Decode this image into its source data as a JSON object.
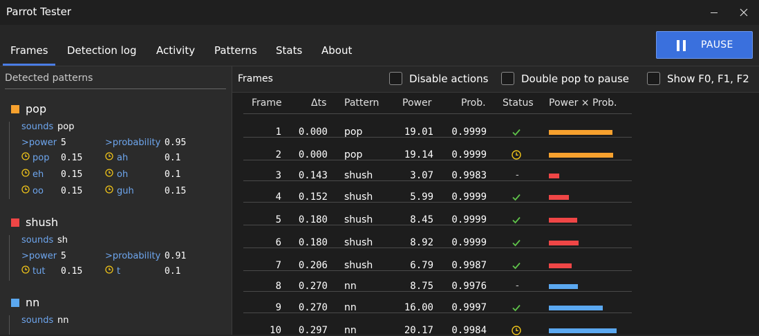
{
  "app_title": "Parrot Tester",
  "tabs": [
    {
      "label": "Frames",
      "active": true
    },
    {
      "label": "Detection log"
    },
    {
      "label": "Activity"
    },
    {
      "label": "Patterns"
    },
    {
      "label": "Stats"
    },
    {
      "label": "About"
    }
  ],
  "pause_button": {
    "label": "PAUSE",
    "icon": "pause-icon"
  },
  "left_panel": {
    "header": "Detected patterns",
    "patterns": [
      {
        "name": "pop",
        "color": "#f7a12e",
        "sounds_label": "sounds",
        "sounds": "pop",
        "rows": [
          [
            "power",
            "5",
            "probability",
            "0.95"
          ],
          [
            "pop",
            "0.15",
            "ah",
            "0.1"
          ],
          [
            "eh",
            "0.15",
            "oh",
            "0.1"
          ],
          [
            "oo",
            "0.15",
            "guh",
            "0.15"
          ]
        ]
      },
      {
        "name": "shush",
        "color": "#ef4646",
        "sounds_label": "sounds",
        "sounds": "sh",
        "rows": [
          [
            "power",
            "5",
            "probability",
            "0.91"
          ],
          [
            "tut",
            "0.15",
            "t",
            "0.1"
          ]
        ]
      },
      {
        "name": "nn",
        "color": "#5ba8f0",
        "sounds_label": "sounds",
        "sounds": "nn"
      }
    ],
    "prefix_gt": ">",
    "clock_icon": "clock-icon"
  },
  "right_panel": {
    "title": "Frames",
    "checkboxes": [
      {
        "label": "Disable actions",
        "checked": false
      },
      {
        "label": "Double pop to pause",
        "checked": false
      },
      {
        "label": "Show F0, F1, F2",
        "checked": false
      }
    ],
    "columns": [
      "Frame",
      "Δts",
      "Pattern",
      "Power",
      "Prob.",
      "Status",
      "Power × Prob."
    ],
    "rows": [
      {
        "frame": "1",
        "dts": "0.000",
        "pattern": "pop",
        "power": "19.01",
        "prob": "0.9999",
        "status": "check"
      },
      {
        "frame": "2",
        "dts": "0.000",
        "pattern": "pop",
        "power": "19.14",
        "prob": "0.9999",
        "status": "clock"
      },
      {
        "frame": "3",
        "dts": "0.143",
        "pattern": "shush",
        "power": "3.07",
        "prob": "0.9983",
        "status": "-"
      },
      {
        "frame": "4",
        "dts": "0.152",
        "pattern": "shush",
        "power": "5.99",
        "prob": "0.9999",
        "status": "check"
      },
      {
        "frame": "5",
        "dts": "0.180",
        "pattern": "shush",
        "power": "8.45",
        "prob": "0.9999",
        "status": "check"
      },
      {
        "frame": "6",
        "dts": "0.180",
        "pattern": "shush",
        "power": "8.92",
        "prob": "0.9999",
        "status": "check"
      },
      {
        "frame": "7",
        "dts": "0.206",
        "pattern": "shush",
        "power": "6.79",
        "prob": "0.9987",
        "status": "check"
      },
      {
        "frame": "8",
        "dts": "0.270",
        "pattern": "nn",
        "power": "8.75",
        "prob": "0.9976",
        "status": "-"
      },
      {
        "frame": "9",
        "dts": "0.270",
        "pattern": "nn",
        "power": "16.00",
        "prob": "0.9997",
        "status": "check"
      },
      {
        "frame": "10",
        "dts": "0.297",
        "pattern": "nn",
        "power": "20.17",
        "prob": "0.9984",
        "status": "clock"
      }
    ],
    "pattern_colors": {
      "pop": "#f7a12e",
      "shush": "#ef4646",
      "nn": "#5ba8f0"
    },
    "status_colors": {
      "check": "#5fc34a",
      "clock": "#f0c419"
    }
  }
}
